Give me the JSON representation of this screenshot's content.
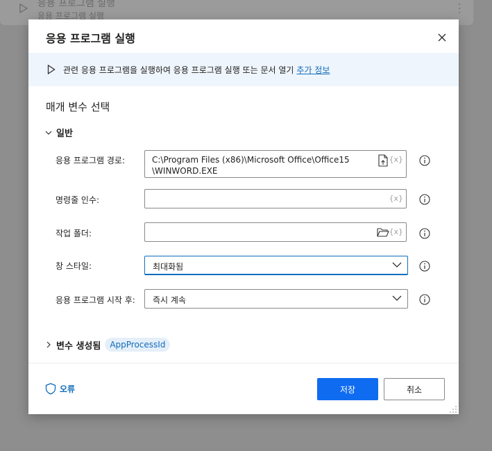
{
  "background_card": {
    "title": "응용 프로그램 실행",
    "subtitle": "응용 프로그램 실행"
  },
  "dialog": {
    "title": "응용 프로그램 실행",
    "info": {
      "text": "관련 응용 프로그램을 실행하여 응용 프로그램 실행 또는 문서 열기",
      "link": "추가 정보"
    },
    "section_title": "매개 변수 선택",
    "group_label": "일반",
    "fields": {
      "app_path": {
        "label": "응용 프로그램 경로:",
        "value_line1": "C:\\Program Files (x86)\\Microsoft Office\\Office15",
        "value_line2": "\\WINWORD.EXE",
        "var_token": "{x}"
      },
      "cmd_args": {
        "label": "명령줄 인수:",
        "value": "",
        "var_token": "{x}"
      },
      "work_folder": {
        "label": "작업 폴더:",
        "value": "",
        "var_token": "{x}"
      },
      "window_style": {
        "label": "창 스타일:",
        "selected": "최대화됨"
      },
      "after_launch": {
        "label": "응용 프로그램 시작 후:",
        "selected": "즉시 계속"
      }
    },
    "variables": {
      "label": "변수 생성됨",
      "chip": "AppProcessId"
    },
    "footer": {
      "error_label": "오류",
      "save_label": "저장",
      "cancel_label": "취소"
    },
    "colors": {
      "accent": "#0f6cbd",
      "primary_button": "#0f6cf0",
      "info_bar": "#eff5fc"
    }
  }
}
